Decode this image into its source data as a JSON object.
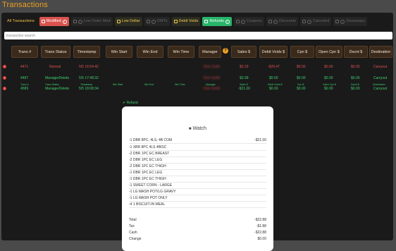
{
  "page_title": "Transactions",
  "filters": [
    {
      "label": "All Transactions",
      "style": "plain"
    },
    {
      "label": "Modified",
      "style": "red",
      "icon": "info"
    },
    {
      "label": "Low Order Mod",
      "style": "dim",
      "icon": "info"
    },
    {
      "label": "Low Dollar",
      "style": "yellow",
      "icon": "check"
    },
    {
      "label": "OWTs",
      "style": "dim",
      "icon": "check"
    },
    {
      "label": "Debit Voids",
      "style": "yellow",
      "icon": "check"
    },
    {
      "label": "Refunds",
      "style": "green",
      "icon": "check"
    },
    {
      "label": "Coupons",
      "style": "dim",
      "icon": "info"
    },
    {
      "label": "Discounts",
      "style": "dim",
      "icon": "info"
    },
    {
      "label": "Canceled",
      "style": "dim",
      "icon": "info"
    },
    {
      "label": "Giveaways",
      "style": "dim",
      "icon": "info"
    }
  ],
  "search": {
    "placeholder": "transaction search"
  },
  "columns": [
    "Trans #",
    "Trans Status",
    "Timestamp",
    "Win Start",
    "Win End",
    "Win Time",
    "Manager",
    "Sales $",
    "Debit Voids $",
    "Cpn $",
    "Open Cpn $",
    "Dscnt $",
    "Destination"
  ],
  "rows": [
    {
      "trans": "4471",
      "status": "Normal",
      "timestamp": "5/5 16:54:42",
      "manager": "Rob Smith",
      "sales": "$3.29",
      "debit_voids": "-$29.47",
      "cpn": "$0.00",
      "open_cpn": "$0.00",
      "dscnt": "$0.00",
      "destination": "Carryout"
    },
    {
      "trans": "4497",
      "status": "ManagerDelete",
      "timestamp": "5/5 17:48:32",
      "manager": "Rob Smith",
      "sales": "$3.99",
      "debit_voids": "$0.00",
      "cpn": "$0.00",
      "open_cpn": "$0.00",
      "dscnt": "$0.00",
      "destination": "Carryout"
    }
  ],
  "selected_row": {
    "trans": "4589",
    "status": "ManagerDelete",
    "timestamp": "5/5 18:08:34",
    "manager": "Rob Smith",
    "sales": "-$21.00",
    "debit_voids": "$0.00",
    "cpn": "$0.00",
    "open_cpn": "$0.00",
    "dscnt": "$0.00",
    "destination": "Carryout"
  },
  "refund_label": "Refund",
  "receipt": {
    "title": "Watch",
    "lines": [
      {
        "item": "-1 DBR 8PC, 4LS, 4B COM",
        "price": "-$21.00"
      },
      {
        "item": "-1 XBR 8PC 4LS 4BISC",
        "price": ""
      },
      {
        "item": "-2 DBR 1PC EC BREAST",
        "price": ""
      },
      {
        "item": "-2 DBR 1PC EC LEG",
        "price": ""
      },
      {
        "item": "-2 DBR 1PC EC THIGH",
        "price": ""
      },
      {
        "item": "-1 DBR 1PC EC LEG",
        "price": ""
      },
      {
        "item": "-1 DBR 1PC EC THIGH",
        "price": ""
      },
      {
        "item": "-1 SWEET CORN - LARGE",
        "price": ""
      },
      {
        "item": "-1 LG MASH POT/LG GRAVY",
        "price": ""
      },
      {
        "item": "-1 LG MASH POT ONLY",
        "price": ""
      },
      {
        "item": "-4 1 BISCUIT-IN MEAL",
        "price": ""
      }
    ],
    "totals": [
      {
        "label": "Total",
        "value": "-$22.88"
      },
      {
        "label": "Tax",
        "value": "-$1.88"
      },
      {
        "label": "Cash",
        "value": "-$22.88"
      },
      {
        "label": "Change",
        "value": "$0.00"
      }
    ]
  }
}
